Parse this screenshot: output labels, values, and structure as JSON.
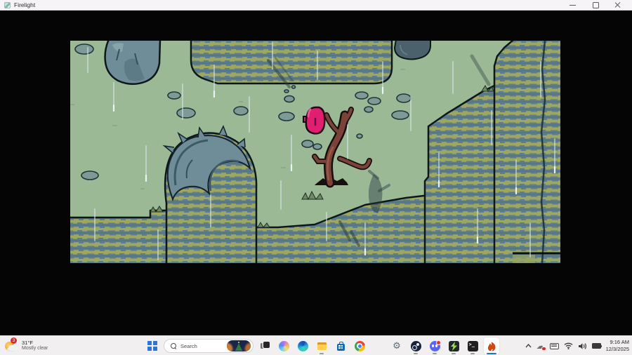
{
  "window": {
    "title": "Firelight",
    "controls": [
      "minimize",
      "maximize",
      "close"
    ]
  },
  "game": {
    "name": "Firelight",
    "scene": "rainy green cliff field, pixel art",
    "entities": [
      "pink-blob-character",
      "dead-tree",
      "boulder",
      "scattered-rocks",
      "striped-cliffs",
      "rain-streaks"
    ]
  },
  "taskbar": {
    "weather": {
      "temperature": "31°F",
      "condition": "Mostly clear",
      "badge_count": "3",
      "icon": "sun-behind-cloud-icon"
    },
    "start": {
      "icon": "windows-start-icon"
    },
    "search": {
      "placeholder": "Search",
      "icon": "search-icon",
      "thumbnail": "holiday-tree-thumbnail"
    },
    "terminal_glyph": ">_",
    "apps": [
      {
        "name": "task-view",
        "running": false,
        "active": false
      },
      {
        "name": "copilot",
        "running": false,
        "active": false
      },
      {
        "name": "edge",
        "running": false,
        "active": false
      },
      {
        "name": "file-explorer",
        "running": true,
        "active": false
      },
      {
        "name": "microsoft-store",
        "running": false,
        "active": false
      },
      {
        "name": "chrome",
        "running": false,
        "active": false
      },
      {
        "name": "settings",
        "running": false,
        "active": false
      },
      {
        "name": "steam",
        "running": true,
        "active": false
      },
      {
        "name": "discord",
        "running": true,
        "active": false,
        "badge": true
      },
      {
        "name": "lightning-app",
        "running": true,
        "active": false
      },
      {
        "name": "terminal",
        "running": true,
        "active": false
      },
      {
        "name": "firelight",
        "running": true,
        "active": true
      }
    ],
    "tray": {
      "icons": [
        "hidden-icons-chevron",
        "cloud-sync-error",
        "touch-keyboard",
        "wifi",
        "volume",
        "battery"
      ],
      "time": "9:16 AM",
      "date": "12/3/2025"
    }
  },
  "palette": {
    "ground": "#9bb995",
    "ground_fleck": "#8aab86",
    "cliff_teal": "#5e7d8c",
    "cliff_stripe": "#9ea75f",
    "cliff_dark": "#0d171b",
    "boulder": "#6f8d98",
    "boulder_shadow": "#5b7884",
    "rock": "#7d9a96",
    "trunk": "#7b4238",
    "trunk_light": "#9b5a47",
    "blob_pink": "#e01f70",
    "blob_dark": "#97115a",
    "rain": "#d7e9ee",
    "accent_blue": "#1876d0"
  }
}
